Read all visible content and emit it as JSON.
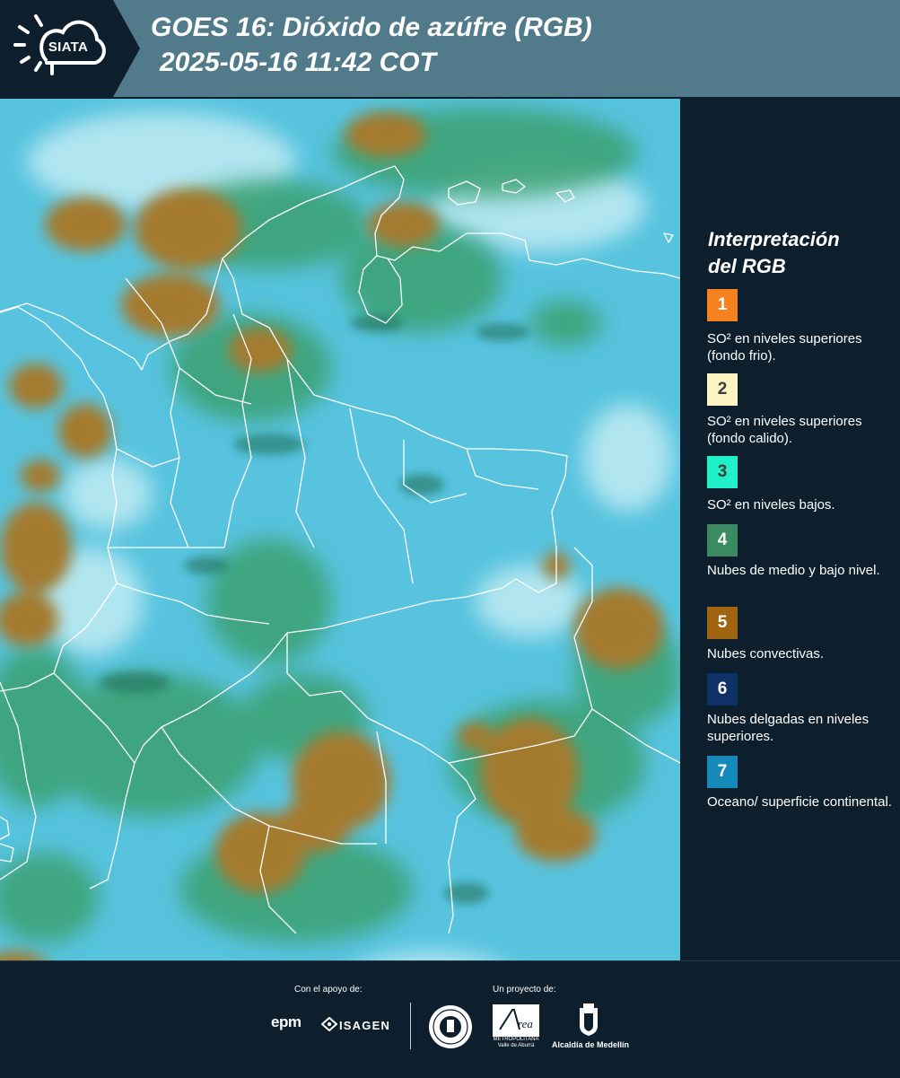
{
  "header": {
    "logo_text": "SIATA",
    "title_line1": "GOES 16: Dióxido de azúfre (RGB)",
    "title_line2": "2025-05-16 11:42 COT"
  },
  "legend": {
    "title_line1": "Interpretación",
    "title_line2": "del RGB",
    "items": [
      {
        "number": "1",
        "color": "#f5821f",
        "description": "SO² en niveles superiores (fondo frio)."
      },
      {
        "number": "2",
        "color": "#fcf4c2",
        "description": "SO² en niveles superiores (fondo calido)."
      },
      {
        "number": "3",
        "color": "#1ff0c8",
        "description": "SO² en niveles bajos."
      },
      {
        "number": "4",
        "color": "#3b8a62",
        "description": "Nubes de medio y bajo nivel."
      },
      {
        "number": "5",
        "color": "#a06410",
        "description": "Nubes convectivas."
      },
      {
        "number": "6",
        "color": "#10306a",
        "description": "Nubes delgadas en niveles superiores."
      },
      {
        "number": "7",
        "color": "#1589b8",
        "description": "Oceano/ superficie continental."
      }
    ]
  },
  "footer": {
    "support_label": "Con el apoyo de:",
    "project_label": "Un proyecto de:",
    "sponsor1": "epm",
    "sponsor2": "ISAGEN",
    "partner1_line1": "METROPOLITANA",
    "partner1_line2": "Valle de Aburrá",
    "partner2": "Alcaldía de Medellín"
  }
}
